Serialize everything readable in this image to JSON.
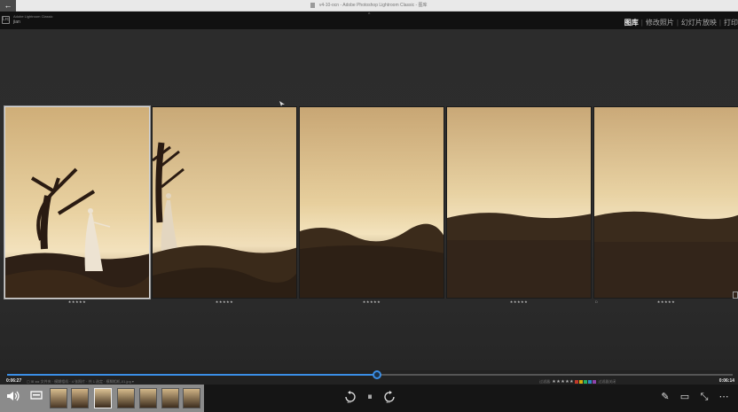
{
  "window": {
    "title": "v4-10-ocn - Adobe Photoshop Lightroom Classic - 图库",
    "back_label": "←"
  },
  "lightroom": {
    "logo": "Lrc",
    "brand": "Adobe Lightroom Classic",
    "user": "jian",
    "caret": "^"
  },
  "modules": [
    {
      "label": "图库",
      "selected": true
    },
    {
      "label": "修改照片",
      "selected": false
    },
    {
      "label": "幻灯片放映",
      "selected": false
    },
    {
      "label": "打印",
      "selected": false
    }
  ],
  "grid": {
    "cells": [
      {
        "number": "",
        "rating": "★★★★★",
        "selected": true
      },
      {
        "number": "",
        "rating": "★★★★★",
        "selected": false
      },
      {
        "number": "",
        "rating": "★★★★★",
        "selected": false
      },
      {
        "number": "",
        "rating": "★★★★★",
        "selected": false
      },
      {
        "number": "D",
        "rating": "★★★★★",
        "selected": false
      }
    ]
  },
  "playback": {
    "elapsed": "0:06:27",
    "total": "0:06:14",
    "progress_fraction": 0.51,
    "info": "▢ ⊞ ◂ ▸   文件夹 · 模糊相机 · 4 张照片 · 共 1 选定 · 模糊相机-01.jpg ▾",
    "filter_label": "过滤器:",
    "filter_stars": "★★★★★",
    "filter_off": "过滤器关闭",
    "swatches": [
      "#c0392b",
      "#d4ac0d",
      "#27ae60",
      "#2e86c1",
      "#8e44ad"
    ]
  },
  "controls": {
    "volume_icon": "volume-icon",
    "caption_icon": "caption-icon",
    "rewind_label": "10",
    "forward_label": "10",
    "pause_glyph": "⏸",
    "edit_glyph": "✎",
    "pip_glyph": "▭",
    "collapse_glyph": "⤡",
    "more_glyph": "⋯"
  }
}
